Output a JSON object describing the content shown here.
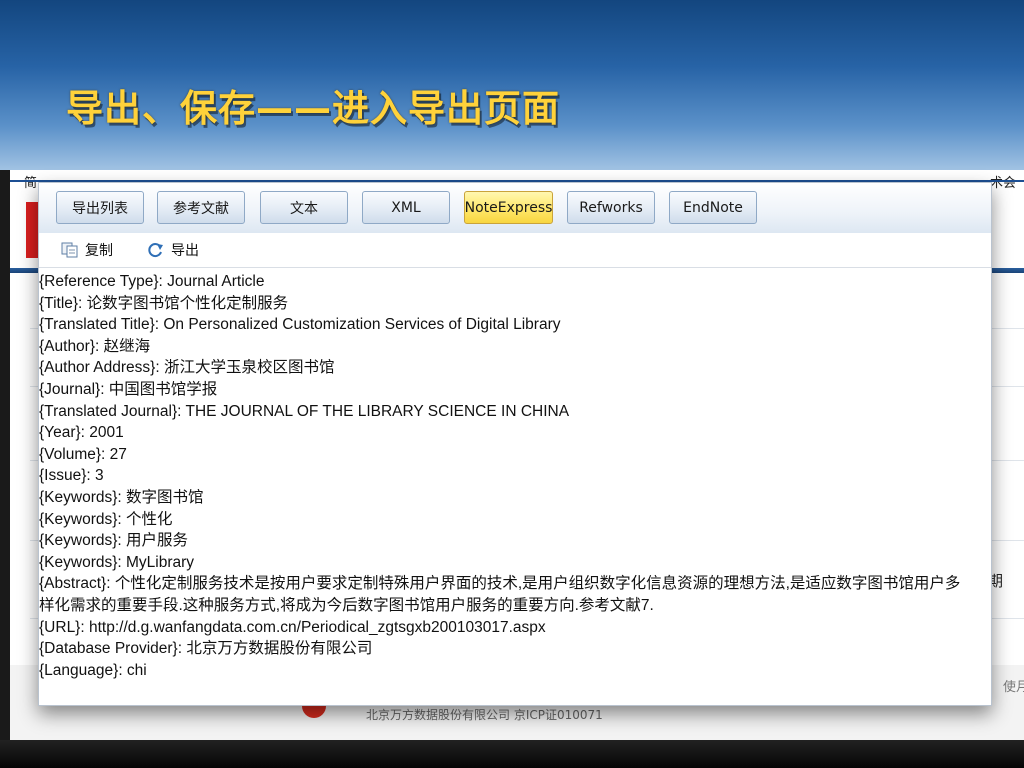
{
  "slide": {
    "title": "导出、保存——进入导出页面"
  },
  "background_page": {
    "corner_left_char": "简",
    "corner_right_text": "术会",
    "right_edge_char": "期",
    "right_edge_text_2": "使月",
    "footer_text": "北京万方数据股份有限公司  京ICP证010071"
  },
  "colors": {
    "title": "#ffd23a",
    "header_band": "#2763a6",
    "active_button": "#ffe76a"
  },
  "export_dialog": {
    "format_buttons": [
      {
        "label": "导出列表",
        "active": false
      },
      {
        "label": "参考文献",
        "active": false
      },
      {
        "label": "文本",
        "active": false
      },
      {
        "label": "XML",
        "active": false
      },
      {
        "label": "NoteExpress",
        "active": true
      },
      {
        "label": "Refworks",
        "active": false
      },
      {
        "label": "EndNote",
        "active": false
      }
    ],
    "actions": [
      {
        "label": "复制",
        "icon": "copy-icon"
      },
      {
        "label": "导出",
        "icon": "export-icon"
      }
    ],
    "record_lines": [
      "{Reference Type}: Journal Article",
      "{Title}: 论数字图书馆个性化定制服务",
      "{Translated Title}: On Personalized Customization Services of Digital Library",
      "{Author}: 赵继海",
      "{Author Address}: 浙江大学玉泉校区图书馆",
      "{Journal}: 中国图书馆学报",
      "{Translated Journal}: THE JOURNAL OF THE LIBRARY SCIENCE IN CHINA",
      "{Year}: 2001",
      "{Volume}: 27",
      "{Issue}: 3",
      "{Keywords}: 数字图书馆",
      "{Keywords}: 个性化",
      "{Keywords}: 用户服务",
      "{Keywords}: MyLibrary",
      "{Abstract}: 个性化定制服务技术是按用户要求定制特殊用户界面的技术,是用户组织数字化信息资源的理想方法,是适应数字图书馆用户多样化需求的重要手段.这种服务方式,将成为今后数字图书馆用户服务的重要方向.参考文献7.",
      "{URL}: http://d.g.wanfangdata.com.cn/Periodical_zgtsgxb200103017.aspx",
      "{Database Provider}: 北京万方数据股份有限公司",
      "{Language}: chi"
    ]
  }
}
